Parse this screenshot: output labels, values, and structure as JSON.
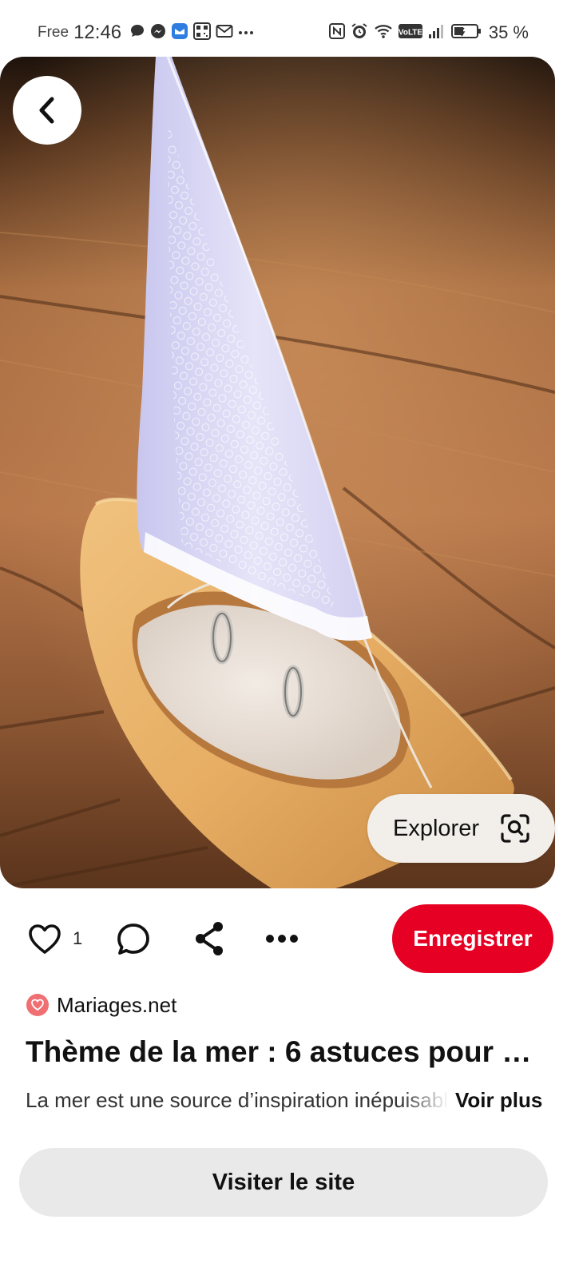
{
  "status_bar": {
    "carrier": "Free",
    "time": "12:46",
    "battery": "35 %",
    "left_icons": [
      "chat-bubble-icon",
      "messenger-icon",
      "mail-app-icon",
      "qr-code-icon",
      "email-icon",
      "more-dots-icon"
    ],
    "right_icons": [
      "nfc-icon",
      "alarm-icon",
      "wifi-icon",
      "volte-icon",
      "signal-icon",
      "battery-icon"
    ],
    "volte_label": "VoLTE"
  },
  "image": {
    "description_icon": "sailboat-ring-holder-photo"
  },
  "back_button": {
    "icon": "chevron-left-icon"
  },
  "explorer_button": {
    "label": "Explorer",
    "icon": "visual-search-icon"
  },
  "actions": {
    "like_count": "1",
    "like_icon": "heart-icon",
    "comment_icon": "comment-icon",
    "share_icon": "share-icon",
    "more_icon": "more-icon",
    "save_label": "Enregistrer"
  },
  "source": {
    "name": "Mariages.net",
    "logo_icon": "heart-logo-icon"
  },
  "pin": {
    "title": "Thème de la mer : 6 astuces pour …",
    "description": "La mer est une source d’inspiration inépuisable",
    "see_more_label": "Voir plus"
  },
  "visit_button": {
    "label": "Visiter le site"
  },
  "colors": {
    "save": "#e60023",
    "visit_bg": "#e9e9e9",
    "explorer_bg": "#f2efea",
    "source_logo": "#ef6f73"
  }
}
